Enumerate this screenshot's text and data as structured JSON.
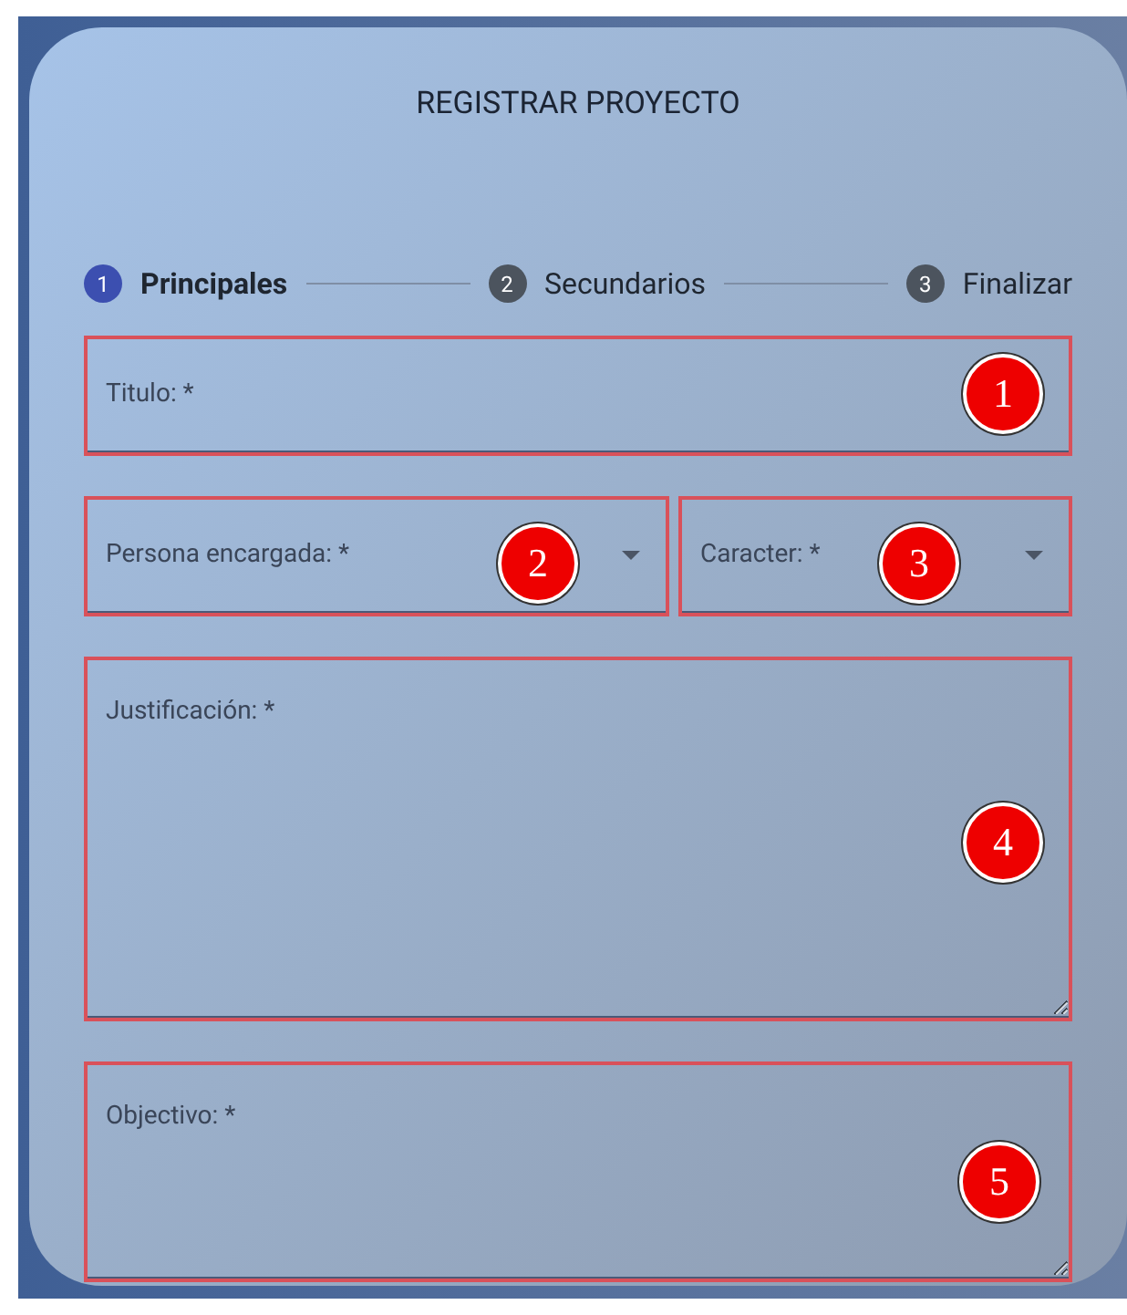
{
  "title": "REGISTRAR PROYECTO",
  "steps": [
    {
      "number": "1",
      "label": "Principales",
      "selected": true
    },
    {
      "number": "2",
      "label": "Secundarios",
      "selected": false
    },
    {
      "number": "3",
      "label": "Finalizar",
      "selected": false
    }
  ],
  "rows": [
    [
      {
        "kind": "text",
        "placeholder": "Titulo: *",
        "marker": "1"
      }
    ],
    [
      {
        "kind": "select",
        "placeholder": "Persona encargada: *",
        "marker": "2"
      },
      {
        "kind": "select",
        "placeholder": "Caracter: *",
        "marker": "3"
      }
    ],
    [
      {
        "kind": "textarea",
        "placeholder": "Justificación: *",
        "marker": "4"
      }
    ],
    [
      {
        "kind": "textarea",
        "placeholder": "Objectivo: *",
        "marker": "5"
      }
    ]
  ]
}
